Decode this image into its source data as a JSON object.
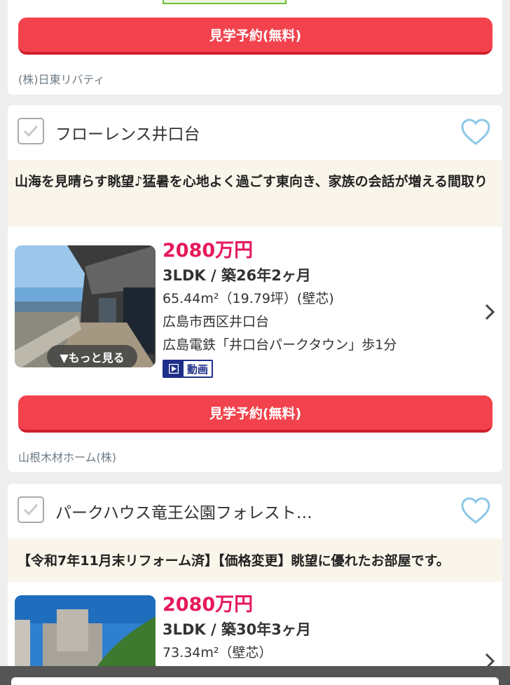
{
  "card0": {
    "reserve_label": "見学予約(無料)",
    "company": "(株)日東リバティ"
  },
  "card1": {
    "name": "フローレンス井口台",
    "catch": "山海を見晴らす眺望♪猛暑を心地よく過ごす東向き、家族の会話が増える間取り",
    "price": "2080万円",
    "layout": "3LDK / 築26年2ヶ月",
    "area": "65.44m²（19.79坪）(壁芯)",
    "address": "広島市西区井口台",
    "station": "広島電鉄「井口台パークタウン」歩1分",
    "more_label": "▼もっと見る",
    "video_label": "動画",
    "reserve_label": "見学予約(無料)",
    "company": "山根木材ホーム(株)"
  },
  "card2": {
    "name": "パークハウス竜王公園フォレスト…",
    "catch": "【令和7年11月末リフォーム済】【価格変更】眺望に優れたお部屋です。",
    "price": "2080万円",
    "layout": "3LDK / 築30年3ヶ月",
    "area": "73.34m²（壁芯）"
  },
  "colors": {
    "price": "#e6195a",
    "reserve_button": "#f2424d",
    "heart": "#8ec8e8",
    "catch_bg": "#f9f5ea",
    "video_badge": "#1e2f8a"
  },
  "icons": [
    "checkbox-icon",
    "heart-icon",
    "chevron-right-icon",
    "play-icon"
  ]
}
